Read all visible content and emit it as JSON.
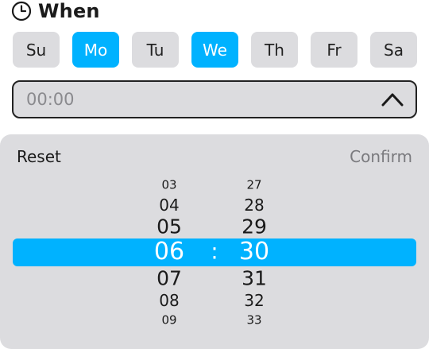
{
  "header": {
    "title": "When",
    "icon": "clock-icon"
  },
  "days": [
    {
      "label": "Su",
      "selected": false
    },
    {
      "label": "Mo",
      "selected": true
    },
    {
      "label": "Tu",
      "selected": false
    },
    {
      "label": "We",
      "selected": true
    },
    {
      "label": "Th",
      "selected": false
    },
    {
      "label": "Fr",
      "selected": false
    },
    {
      "label": "Sa",
      "selected": false
    }
  ],
  "time_field": {
    "value": "00:00",
    "icon": "chevron-up-icon"
  },
  "picker": {
    "reset_label": "Reset",
    "confirm_label": "Confirm",
    "separator": ":",
    "hours": [
      "03",
      "04",
      "05",
      "06",
      "07",
      "08",
      "09"
    ],
    "minutes": [
      "27",
      "28",
      "29",
      "30",
      "31",
      "32",
      "33"
    ],
    "selected_hour": "06",
    "selected_minute": "30"
  },
  "colors": {
    "accent": "#00b2ff",
    "surface": "#dcdcdf",
    "text": "#1a1a1a",
    "muted_text": "#7a7a7e"
  }
}
